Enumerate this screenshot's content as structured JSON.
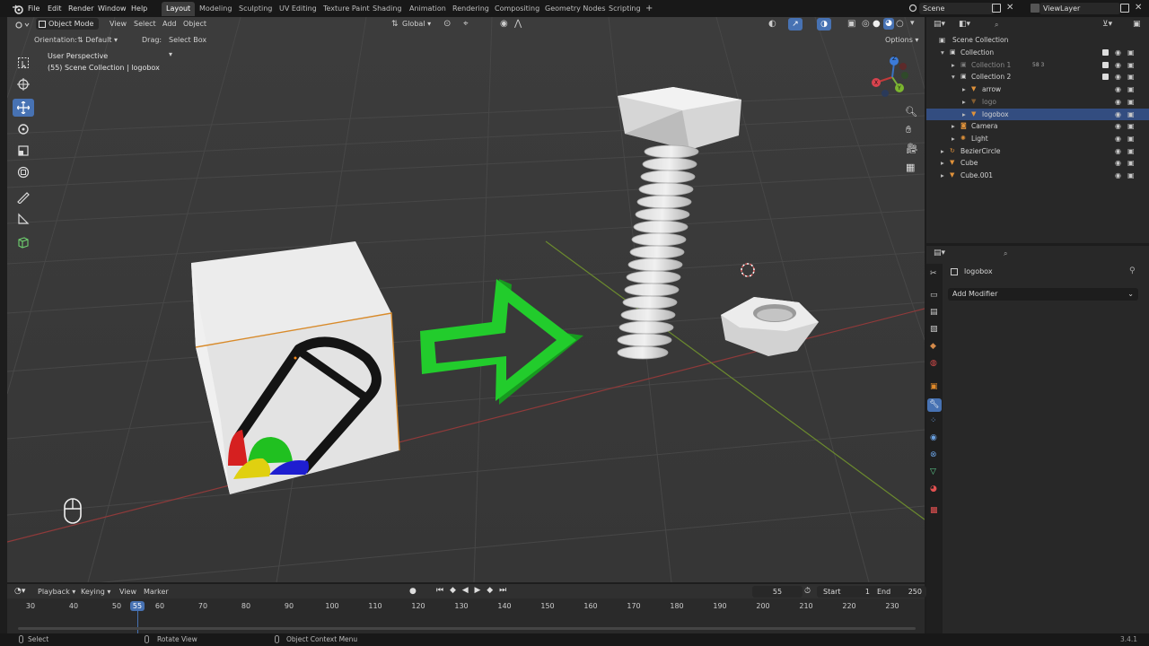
{
  "app": {
    "menus": [
      "File",
      "Edit",
      "Render",
      "Window",
      "Help"
    ],
    "workspaces": [
      "Layout",
      "Modeling",
      "Sculpting",
      "UV Editing",
      "Texture Paint",
      "Shading",
      "Animation",
      "Rendering",
      "Compositing",
      "Geometry Nodes",
      "Scripting"
    ],
    "active_workspace": "Layout",
    "add_tab": "+",
    "scene": "Scene",
    "view_layer": "ViewLayer"
  },
  "viewport_header": {
    "mode": "Object Mode",
    "menus": [
      "View",
      "Select",
      "Add",
      "Object"
    ],
    "transform_orientation": "Global",
    "options_label": "Options"
  },
  "tool_settings": {
    "orientation_label": "Orientation:",
    "orientation_value": "Default",
    "drag_label": "Drag:",
    "drag_value": "Select Box"
  },
  "viewport": {
    "perspective": "User Perspective",
    "context": "(55) Scene Collection | logobox",
    "gizmo": {
      "x": "X",
      "y": "Y",
      "z": "Z"
    }
  },
  "outliner": {
    "root": "Scene Collection",
    "rows": [
      {
        "label": "Collection",
        "indent": 1,
        "arrow": "▾",
        "icon": "collection-icon",
        "dim": false,
        "selected": false,
        "check": true,
        "extra": ""
      },
      {
        "label": "Collection 1",
        "indent": 2,
        "arrow": "▸",
        "icon": "collection-icon",
        "dim": true,
        "selected": false,
        "check": true,
        "extra": "58 3"
      },
      {
        "label": "Collection 2",
        "indent": 2,
        "arrow": "▾",
        "icon": "collection-icon",
        "dim": false,
        "selected": false,
        "check": true,
        "extra": ""
      },
      {
        "label": "arrow",
        "indent": 3,
        "arrow": "▸",
        "icon": "mesh-icon",
        "dim": false,
        "selected": false,
        "check": false,
        "extra": ""
      },
      {
        "label": "logo",
        "indent": 3,
        "arrow": "▸",
        "icon": "mesh-icon",
        "dim": true,
        "selected": false,
        "check": false,
        "extra": ""
      },
      {
        "label": "logobox",
        "indent": 3,
        "arrow": "▸",
        "icon": "mesh-icon",
        "dim": false,
        "selected": true,
        "check": false,
        "extra": ""
      },
      {
        "label": "Camera",
        "indent": 2,
        "arrow": "▸",
        "icon": "camera-icon",
        "dim": false,
        "selected": false,
        "check": false,
        "extra": ""
      },
      {
        "label": "Light",
        "indent": 2,
        "arrow": "▸",
        "icon": "light-icon",
        "dim": false,
        "selected": false,
        "check": false,
        "extra": ""
      },
      {
        "label": "BezierCircle",
        "indent": 1,
        "arrow": "▸",
        "icon": "curve-icon",
        "dim": false,
        "selected": false,
        "check": false,
        "extra": ""
      },
      {
        "label": "Cube",
        "indent": 1,
        "arrow": "▸",
        "icon": "mesh-icon",
        "dim": false,
        "selected": false,
        "check": false,
        "extra": ""
      },
      {
        "label": "Cube.001",
        "indent": 1,
        "arrow": "▸",
        "icon": "mesh-icon",
        "dim": false,
        "selected": false,
        "check": false,
        "extra": ""
      }
    ]
  },
  "properties": {
    "object_name": "logobox",
    "add_modifier": "Add Modifier"
  },
  "timeline": {
    "menus": [
      "Playback",
      "Keying",
      "View",
      "Marker"
    ],
    "current_frame": "55",
    "start_label": "Start",
    "start_value": "1",
    "end_label": "End",
    "end_value": "250",
    "ticks": [
      "30",
      "40",
      "50",
      "55",
      "60",
      "70",
      "80",
      "90",
      "100",
      "110",
      "120",
      "130",
      "140",
      "150",
      "160",
      "170",
      "180",
      "190",
      "200",
      "210",
      "220",
      "230"
    ],
    "playhead": "55"
  },
  "statusbar": {
    "select": "Select",
    "rotate_view": "Rotate View",
    "context_menu": "Object Context Menu",
    "version": "3.4.1"
  },
  "colors": {
    "accent": "#4772b3",
    "arrow_green": "#1fbf2a",
    "header": "#181818",
    "panel": "#282828",
    "viewport": "#393939"
  }
}
